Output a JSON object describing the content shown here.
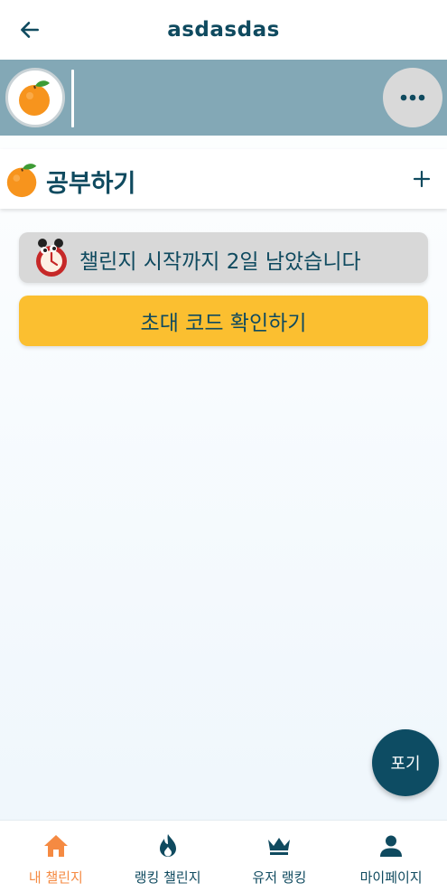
{
  "header": {
    "title": "asdasdas",
    "back_icon": "arrow-left-icon"
  },
  "members": {
    "avatar_icon": "orange-icon",
    "more_icon": "more-horizontal-icon"
  },
  "challenge": {
    "emoji_icon": "orange-icon",
    "name": "공부하기",
    "add_icon": "plus-icon"
  },
  "countdown": {
    "icon": "alarm-clock-icon",
    "text": "챌린지 시작까지 2일 남았습니다"
  },
  "invite": {
    "label": "초대 코드 확인하기"
  },
  "fab": {
    "label": "포기"
  },
  "nav": {
    "items": [
      {
        "label": "내 챌린지",
        "icon": "home-icon",
        "active": true
      },
      {
        "label": "랭킹 챌린지",
        "icon": "flame-icon",
        "active": false
      },
      {
        "label": "유저 랭킹",
        "icon": "crown-icon",
        "active": false
      },
      {
        "label": "마이페이지",
        "icon": "person-icon",
        "active": false
      }
    ]
  },
  "colors": {
    "primary": "#0f4a5f",
    "accent": "#f58a42",
    "strip": "#83a8b6",
    "invite": "#fbbf30",
    "fab": "#0d4c63"
  }
}
